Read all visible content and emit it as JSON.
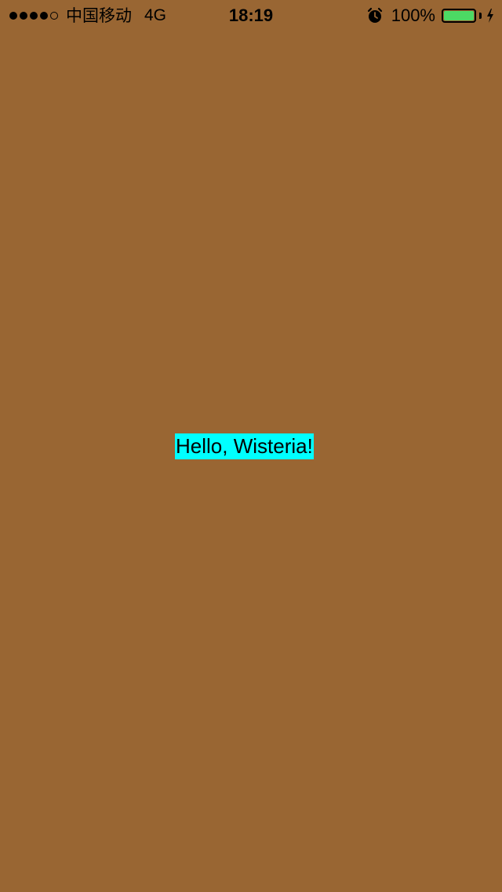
{
  "status_bar": {
    "signal_bars": 4,
    "signal_total": 5,
    "carrier": "中国移动",
    "network": "4G",
    "time": "18:19",
    "battery_percent": "100%",
    "battery_level": 1.0,
    "battery_color": "#4cd964",
    "icons": [
      "alarm-icon",
      "battery-icon",
      "charging-bolt-icon"
    ]
  },
  "main": {
    "label": "Hello, Wisteria!",
    "background_color": "#996633",
    "label_background_color": "#00ffff"
  }
}
